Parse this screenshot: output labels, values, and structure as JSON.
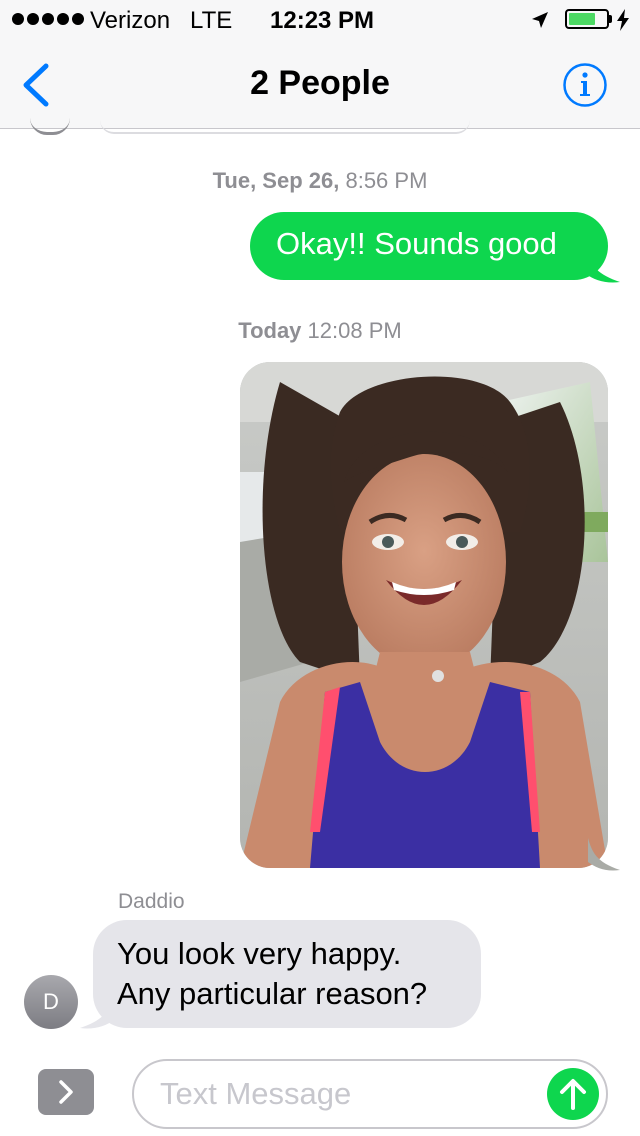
{
  "status_bar": {
    "carrier": "Verizon",
    "network": "LTE",
    "time": "12:23 PM",
    "battery_level": 0.72,
    "icons": [
      "signal-dots",
      "location-arrow-icon",
      "battery-icon",
      "charging-bolt-icon"
    ]
  },
  "nav": {
    "title": "2 People",
    "back_icon": "chevron-left-icon",
    "info_icon": "info-icon"
  },
  "messages": [
    {
      "type": "timestamp",
      "day": "Tue, Sep 26,",
      "time": "8:56 PM"
    },
    {
      "type": "outgoing",
      "text": "Okay!! Sounds good"
    },
    {
      "type": "timestamp",
      "day": "Today",
      "time": "12:08 PM"
    },
    {
      "type": "outgoing-photo",
      "description": "selfie"
    },
    {
      "type": "incoming",
      "sender": "Daddio",
      "avatar_initial": "D",
      "lines": [
        "You look very happy.",
        "Any particular reason?"
      ]
    }
  ],
  "input": {
    "placeholder": "Text Message",
    "apps_icon": "chevron-right-icon",
    "send_icon": "arrow-up-icon"
  },
  "colors": {
    "accent": "#007aff",
    "outgoing_bubble": "#0ed64e",
    "incoming_bubble": "#e5e5ea",
    "timestamp": "#8e8e93"
  }
}
